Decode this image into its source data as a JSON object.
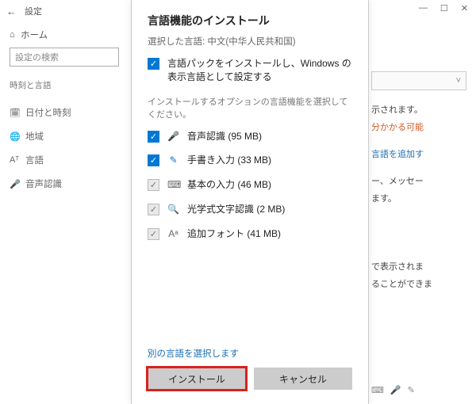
{
  "bg": {
    "app_title": "設定",
    "home": "ホーム",
    "search_placeholder": "設定の検索",
    "category": "時刻と言語",
    "nav": [
      {
        "icon": "🗓",
        "label": "日付と時刻"
      },
      {
        "icon": "🌐",
        "label": "地域"
      },
      {
        "icon": "Aᵀ",
        "label": "言語"
      },
      {
        "icon": "🎤",
        "label": "音声認識"
      }
    ],
    "right": {
      "drop_glyph": "˅",
      "frag1": "示されます。",
      "frag2": "分かかる可能",
      "frag3": "言語を追加す",
      "frag4a": "ー、メッセー",
      "frag4b": "ます。",
      "frag5a": "で表示されま",
      "frag5b": "ることができま"
    },
    "sysicons": [
      "—",
      "☐",
      "✕"
    ]
  },
  "modal": {
    "title": "言語機能のインストール",
    "selected_prefix": "選択した言語:",
    "selected_lang": "中文(中华人民共和国)",
    "main_option": "言語パックをインストールし、Windows の表示言語として設定する",
    "instruction": "インストールするオプションの言語機能を選択してください。",
    "features": [
      {
        "checked": true,
        "locked": false,
        "icon": "🎤",
        "icon_name": "mic-icon",
        "label": "音声認識 (95 MB)"
      },
      {
        "checked": true,
        "locked": false,
        "icon": "✎",
        "icon_name": "pen-icon",
        "label": "手書き入力 (33 MB)"
      },
      {
        "checked": true,
        "locked": true,
        "icon": "⌨",
        "icon_name": "keyboard-icon",
        "label": "基本の入力 (46 MB)"
      },
      {
        "checked": true,
        "locked": true,
        "icon": "🔍",
        "icon_name": "ocr-icon",
        "label": "光学式文字認識 (2 MB)"
      },
      {
        "checked": true,
        "locked": true,
        "icon": "Aᵃ",
        "icon_name": "font-icon",
        "label": "追加フォント (41 MB)"
      }
    ],
    "alt_link": "別の言語を選択します",
    "install": "インストール",
    "cancel": "キャンセル"
  }
}
